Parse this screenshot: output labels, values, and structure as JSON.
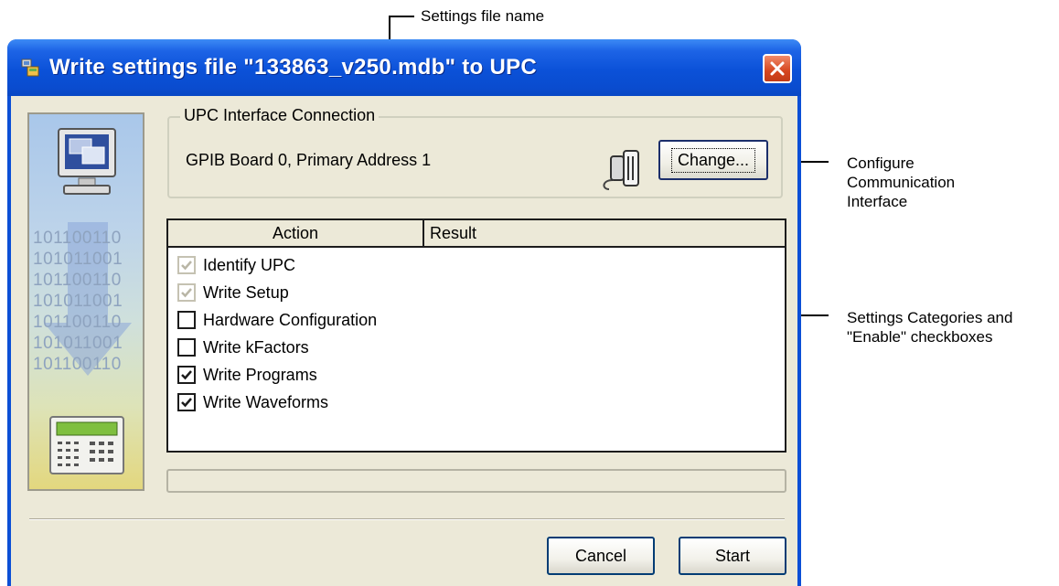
{
  "annotations": {
    "file_name_note": "Settings file name",
    "configure_note": [
      "Configure",
      "Communication",
      "Interface"
    ],
    "categories_note": [
      "Settings Categories and",
      "\"Enable\" checkboxes"
    ]
  },
  "window": {
    "title": "Write settings file \"133863_v250.mdb\" to UPC",
    "close_icon": "close-icon",
    "app_icon": "upc-app-icon"
  },
  "side_panel": {
    "binary_rows": [
      "101100110",
      "101011001",
      "101100110",
      "101011001",
      "101100110",
      "101011001",
      "101100110"
    ]
  },
  "connection": {
    "group_label": "UPC Interface Connection",
    "address": "GPIB Board 0, Primary Address 1",
    "change_label": "Change..."
  },
  "action_list": {
    "headers": {
      "action": "Action",
      "result": "Result"
    },
    "items": [
      {
        "label": "Identify UPC",
        "checked": true,
        "enabled": false
      },
      {
        "label": "Write Setup",
        "checked": true,
        "enabled": false
      },
      {
        "label": "Hardware Configuration",
        "checked": false,
        "enabled": true
      },
      {
        "label": "Write kFactors",
        "checked": false,
        "enabled": true
      },
      {
        "label": "Write Programs",
        "checked": true,
        "enabled": true
      },
      {
        "label": "Write Waveforms",
        "checked": true,
        "enabled": true
      }
    ]
  },
  "buttons": {
    "cancel": "Cancel",
    "start": "Start"
  },
  "colors": {
    "titlebar": "#0b51d8",
    "dialog_bg": "#ece9d8",
    "close_button": "#d6461f"
  }
}
